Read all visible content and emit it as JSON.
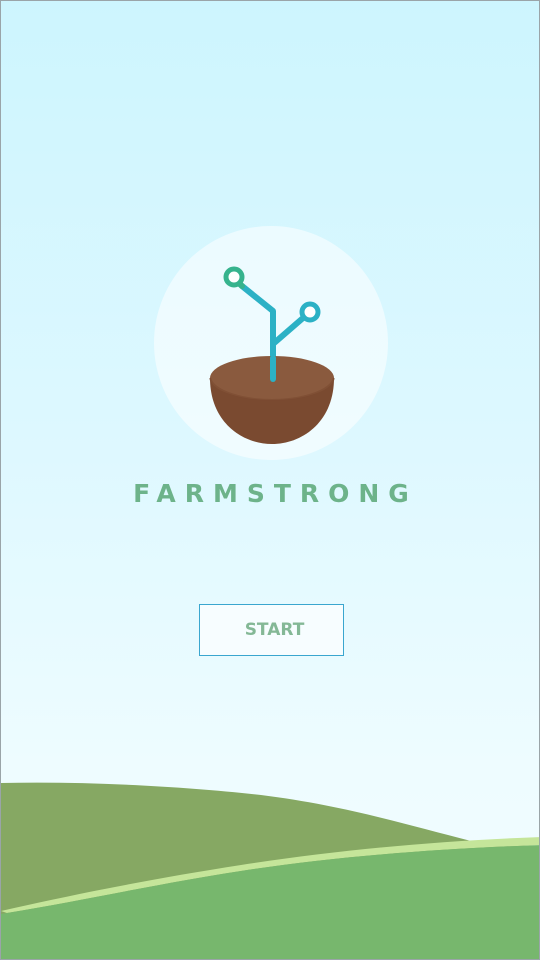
{
  "app": {
    "brand_name": "FARMSTRONG"
  },
  "actions": {
    "start_label": "START"
  },
  "icons": {
    "logo": "sprout-in-pot-icon"
  },
  "colors": {
    "sky_top": "#cdf5fe",
    "sky_bottom": "#f2fdff",
    "brand_text": "#6db38a",
    "button_border": "#3aa6cf",
    "button_text": "#84b896",
    "hill_back": "#86a863",
    "hill_highlight": "#c5e59a",
    "hill_front": "#77b76d",
    "pot": "#7a4a30",
    "stem": "#2cb1c5",
    "leaf_node": "#36b38d"
  }
}
